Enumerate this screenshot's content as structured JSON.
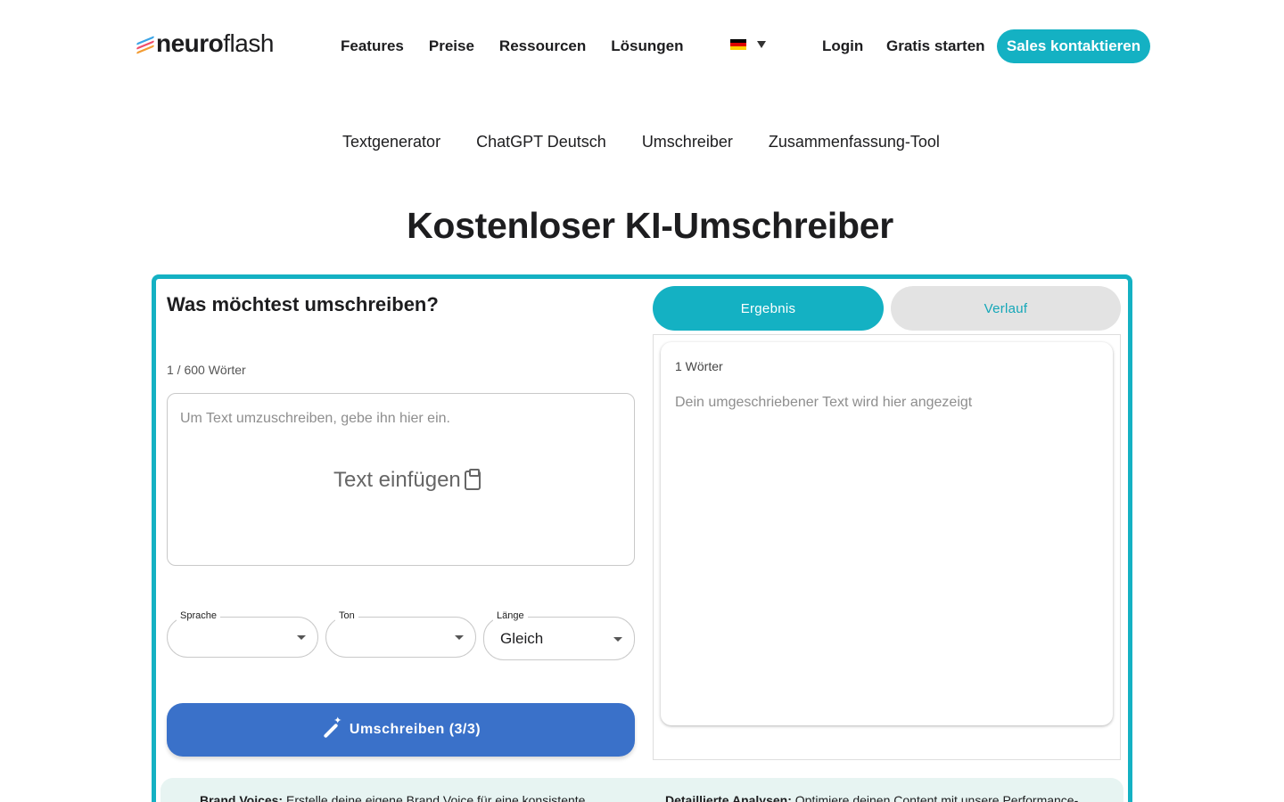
{
  "header": {
    "logo": {
      "bold": "neuro",
      "light": "flash"
    },
    "nav": [
      "Features",
      "Preise",
      "Ressourcen",
      "Lösungen"
    ],
    "login": "Login",
    "gratis": "Gratis starten",
    "sales": "Sales kontaktieren"
  },
  "subnav": [
    "Textgenerator",
    "ChatGPT Deutsch",
    "Umschreiber",
    "Zusammenfassung-Tool"
  ],
  "page_title": "Kostenloser KI-Umschreiber",
  "tool": {
    "question": "Was möchtest umschreiben?",
    "word_count": "1 / 600 Wörter",
    "input_placeholder": "Um Text umzuschreiben, gebe ihn hier ein.",
    "paste_label": "Text einfügen",
    "selects": {
      "sprache": {
        "label": "Sprache",
        "value": ""
      },
      "ton": {
        "label": "Ton",
        "value": ""
      },
      "laenge": {
        "label": "Länge",
        "value": "Gleich"
      }
    },
    "submit_label": "Umschreiben (3/3)",
    "tabs": {
      "result": "Ergebnis",
      "history": "Verlauf"
    },
    "result_count": "1 Wörter",
    "result_placeholder": "Dein umgeschriebener Text wird hier angezeigt"
  },
  "info": {
    "left_bold": "Brand Voices:",
    "left_text": " Erstelle deine eigene Brand Voice für eine konsistente",
    "right_bold": "Detaillierte Analysen:",
    "right_text": " Optimiere deinen Content mit unsere Performance-"
  },
  "colors": {
    "accent": "#14b1c3",
    "button_blue": "#3a71c9",
    "info_bg": "#e7f4f2"
  }
}
